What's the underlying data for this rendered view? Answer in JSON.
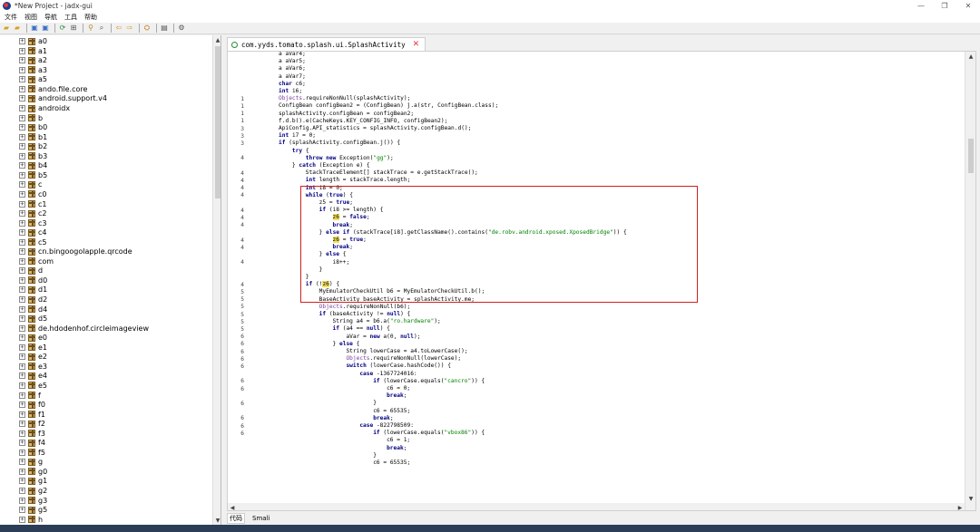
{
  "window": {
    "title": "*New Project - jadx-gui",
    "controls": [
      "—",
      "❐",
      "✕"
    ]
  },
  "menu": [
    "文件",
    "视图",
    "导航",
    "工具",
    "帮助"
  ],
  "toolbar": {
    "icons": [
      "open-icon",
      "add-icon",
      "save-icon",
      "save-all-icon",
      "sync-icon",
      "tree-icon",
      "search-icon",
      "find-icon",
      "back-icon",
      "forward-icon",
      "deobf-icon",
      "log-icon",
      "settings-icon"
    ]
  },
  "tree": {
    "items": [
      "a0",
      "a1",
      "a2",
      "a3",
      "a5",
      "ando.file.core",
      "android.support.v4",
      "androidx",
      "b",
      "b0",
      "b1",
      "b2",
      "b3",
      "b4",
      "b5",
      "c",
      "c0",
      "c1",
      "c2",
      "c3",
      "c4",
      "c5",
      "cn.bingoogolapple.qrcode",
      "com",
      "d",
      "d0",
      "d1",
      "d2",
      "d4",
      "d5",
      "de.hdodenhof.circleimageview",
      "e0",
      "e1",
      "e2",
      "e3",
      "e4",
      "e5",
      "f",
      "f0",
      "f1",
      "f2",
      "f3",
      "f4",
      "f5",
      "g",
      "g0",
      "g1",
      "g2",
      "g3",
      "g5",
      "h"
    ]
  },
  "tab": {
    "label": "com.yyds.tomato.splash.ui.SplashActivity",
    "close": "✕"
  },
  "editor": {
    "gutter": [
      "",
      "",
      "",
      "",
      "",
      "",
      "1",
      "1",
      "1",
      "1",
      "3",
      "3",
      "3",
      "",
      "4",
      "",
      "4",
      "4",
      "4",
      "4",
      "",
      "4",
      "4",
      "4",
      "",
      "4",
      "4",
      "",
      "4",
      "",
      "",
      "4",
      "5",
      "5",
      "5",
      "5",
      "5",
      "5",
      "6",
      "6",
      "6",
      "6",
      "6",
      "",
      "6",
      "6",
      "",
      "6",
      "",
      "6",
      "6",
      "6"
    ],
    "lines": [
      {
        "i": 7,
        "t": "a aVar4;"
      },
      {
        "i": 7,
        "t": "a aVar5;"
      },
      {
        "i": 7,
        "t": "a aVar6;"
      },
      {
        "i": 7,
        "t": "a aVar7;"
      },
      {
        "i": 7,
        "t": "char c6;"
      },
      {
        "i": 7,
        "t": "int i6;"
      },
      {
        "i": 7,
        "t": "Objects.requireNonNull(splashActivity);"
      },
      {
        "i": 7,
        "t": "ConfigBean configBean2 = (ConfigBean) j.a(str, ConfigBean.class);"
      },
      {
        "i": 7,
        "t": "splashActivity.configBean = configBean2;"
      },
      {
        "i": 7,
        "t": "f.d.b().e(CacheKeys.KEY_CONFIG_INFO, configBean2);"
      },
      {
        "i": 7,
        "t": "ApiConfig.API_statistics = splashActivity.configBean.d();"
      },
      {
        "i": 7,
        "t": "int i7 = 0;"
      },
      {
        "i": 7,
        "t": "if (splashActivity.configBean.j()) {"
      },
      {
        "i": 11,
        "t": "try {"
      },
      {
        "i": 15,
        "t": "throw new Exception(\"gg\");"
      },
      {
        "i": 11,
        "t": "} catch (Exception e) {"
      },
      {
        "i": 15,
        "t": "StackTraceElement[] stackTrace = e.getStackTrace();"
      },
      {
        "i": 15,
        "t": "int length = stackTrace.length;"
      },
      {
        "i": 15,
        "t": "int i8 = 0;"
      },
      {
        "i": 15,
        "t": "while (true) {"
      },
      {
        "i": 19,
        "t": "z5 = true;"
      },
      {
        "i": 19,
        "t": "if (i8 >= length) {"
      },
      {
        "i": 23,
        "t": "z6 = false;"
      },
      {
        "i": 23,
        "t": "break;"
      },
      {
        "i": 19,
        "t": "} else if (stackTrace[i8].getClassName().contains(\"de.robv.android.xposed.XposedBridge\")) {"
      },
      {
        "i": 23,
        "t": "z6 = true;"
      },
      {
        "i": 23,
        "t": "break;"
      },
      {
        "i": 19,
        "t": "} else {"
      },
      {
        "i": 23,
        "t": "i8++;"
      },
      {
        "i": 19,
        "t": "}"
      },
      {
        "i": 15,
        "t": "}"
      },
      {
        "i": 15,
        "t": "if (!z6) {"
      },
      {
        "i": 19,
        "t": "MyEmulatorCheckUtil b6 = MyEmulatorCheckUtil.b();"
      },
      {
        "i": 19,
        "t": "BaseActivity baseActivity = splashActivity.me;"
      },
      {
        "i": 19,
        "t": "Objects.requireNonNull(b6);"
      },
      {
        "i": 19,
        "t": "if (baseActivity != null) {"
      },
      {
        "i": 23,
        "t": "String a4 = b6.a(\"ro.hardware\");"
      },
      {
        "i": 23,
        "t": "if (a4 == null) {"
      },
      {
        "i": 27,
        "t": "aVar = new a(0, null);"
      },
      {
        "i": 23,
        "t": "} else {"
      },
      {
        "i": 27,
        "t": "String lowerCase = a4.toLowerCase();"
      },
      {
        "i": 27,
        "t": "Objects.requireNonNull(lowerCase);"
      },
      {
        "i": 27,
        "t": "switch (lowerCase.hashCode()) {"
      },
      {
        "i": 31,
        "t": "case -1367724016:"
      },
      {
        "i": 35,
        "t": "if (lowerCase.equals(\"cancro\")) {"
      },
      {
        "i": 39,
        "t": "c6 = 0;"
      },
      {
        "i": 39,
        "t": "break;"
      },
      {
        "i": 35,
        "t": "}"
      },
      {
        "i": 35,
        "t": "c6 = 65535;"
      },
      {
        "i": 35,
        "t": "break;"
      },
      {
        "i": 31,
        "t": "case -822798509:"
      },
      {
        "i": 35,
        "t": "if (lowerCase.equals(\"vbox86\")) {"
      },
      {
        "i": 39,
        "t": "c6 = 1;"
      },
      {
        "i": 39,
        "t": "break;"
      },
      {
        "i": 35,
        "t": "}"
      },
      {
        "i": 35,
        "t": "c6 = 65535;"
      }
    ]
  },
  "bottom_tabs": [
    "代码",
    "Smali"
  ]
}
